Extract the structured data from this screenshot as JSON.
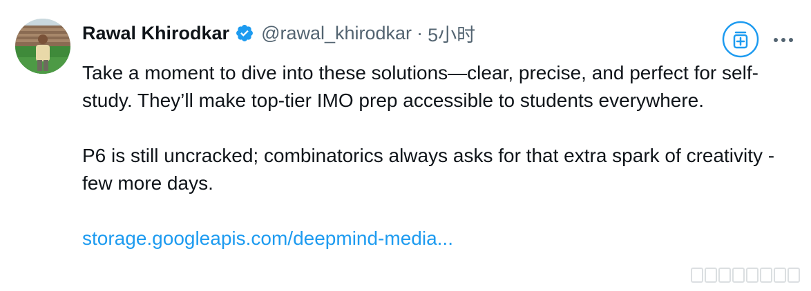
{
  "user": {
    "display_name": "Rawal Khirodkar",
    "handle": "@rawal_khirodkar",
    "separator": "·",
    "time": "5小时",
    "verified": true,
    "avatar_icon": "profile-photo"
  },
  "tweet": {
    "paragraphs": [
      "Take a moment to dive into these solutions—clear, precise, and perfect for self-study. They’ll make top-tier IMO prep accessible to students everywhere.",
      "P6 is still uncracked; combinatorics always asks for that extra spark of creativity - few more days."
    ],
    "link_text": "storage.googleapis.com/deepmind-media..."
  },
  "actions": {
    "grok_icon": "grok-icon",
    "more_icon": "more-options-icon"
  },
  "colors": {
    "text": "#0f1419",
    "secondary": "#536471",
    "accent": "#1d9bf0",
    "verified": "#1d9bf0"
  }
}
